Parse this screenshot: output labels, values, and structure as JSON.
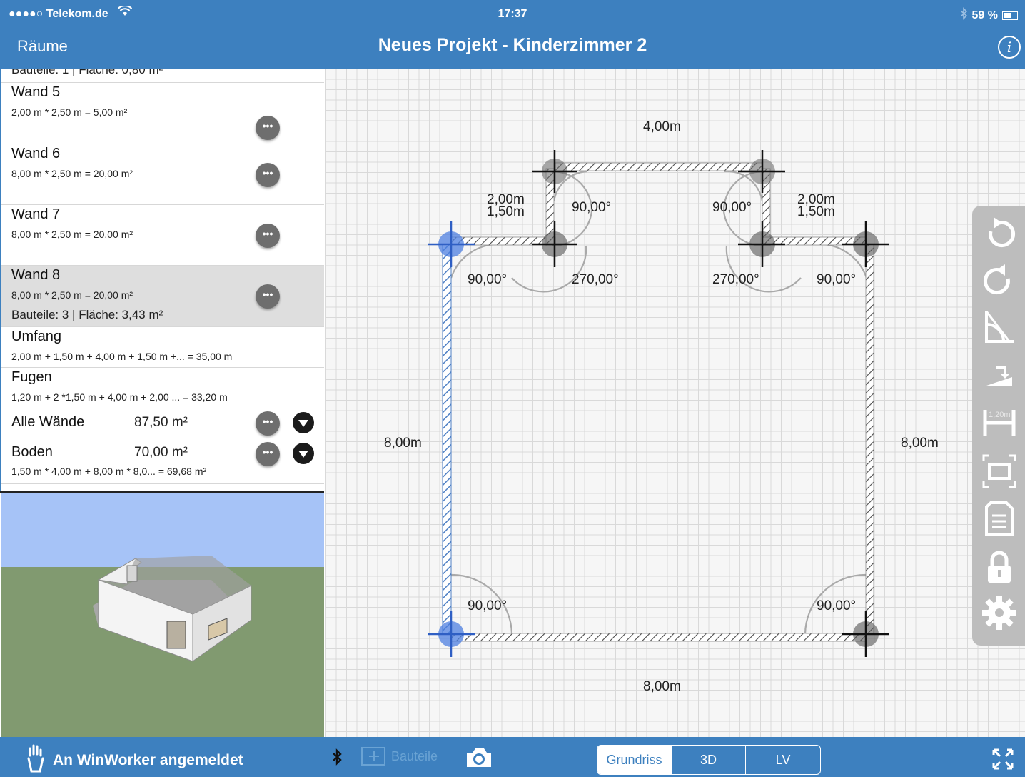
{
  "status_bar": {
    "carrier": "●●●●○ Telekom.de",
    "time": "17:37",
    "battery": "59 %"
  },
  "nav": {
    "back_label": "Räume",
    "title": "Neues Projekt - Kinderzimmer 2",
    "info_glyph": "i"
  },
  "list": {
    "clipped_line": "Bauteile: 1 | Fläche: 0,80 m²",
    "walls": [
      {
        "name": "Wand 5",
        "formula": "2,00 m * 2,50 m = 5,00 m²"
      },
      {
        "name": "Wand 6",
        "formula": "8,00 m * 2,50 m = 20,00 m²"
      },
      {
        "name": "Wand 7",
        "formula": "8,00 m * 2,50 m = 20,00 m²"
      },
      {
        "name": "Wand 8",
        "formula": "8,00 m * 2,50 m = 20,00 m²",
        "sub": "Bauteile: 3 | Fläche: 3,43 m²",
        "selected": true
      }
    ],
    "umfang": {
      "name": "Umfang",
      "formula": "2,00 m + 1,50 m + 4,00 m + 1,50 m +... = 35,00 m"
    },
    "fugen": {
      "name": "Fugen",
      "formula": "1,20 m + 2 *1,50 m + 4,00 m + 2,00 ... = 33,20 m"
    },
    "alle_waende": {
      "name": "Alle Wände",
      "value": "87,50 m²"
    },
    "boden": {
      "name": "Boden",
      "value": "70,00 m²",
      "formula": "1,50 m * 4,00 m + 8,00 m * 8,0... = 69,68 m²"
    },
    "more_glyph": "•••"
  },
  "plan": {
    "dimensions": {
      "top": "4,00m",
      "left_notch": [
        "2,00m",
        "1,50m"
      ],
      "right_notch": [
        "2,00m",
        "1,50m"
      ],
      "left_side": "8,00m",
      "right_side": "8,00m",
      "bottom": "8,00m"
    },
    "angles": {
      "notch_left_top": "90,00°",
      "notch_right_top": "90,00°",
      "corner_top_left": "90,00°",
      "notch_left_inner": "270,00°",
      "notch_right_inner": "270,00°",
      "corner_top_right": "90,00°",
      "corner_bottom_left": "90,00°",
      "corner_bottom_right": "90,00°"
    },
    "colors": {
      "selected_wall": "#4d7fc4",
      "wall_hatch": "#555555",
      "grid": "#d9d9d9"
    }
  },
  "tools": [
    "undo-icon",
    "redo-icon",
    "angle-icon",
    "stairs-icon",
    "dimension-icon",
    "fit-view-icon",
    "document-icon",
    "lock-icon",
    "settings-icon"
  ],
  "tools_dimension_label": "1,20m",
  "bottom_bar": {
    "login_text": "An WinWorker angemeldet",
    "bauteile_label": "Bauteile",
    "segments": [
      "Grundriss",
      "3D",
      "LV"
    ],
    "active_segment": "Grundriss"
  }
}
